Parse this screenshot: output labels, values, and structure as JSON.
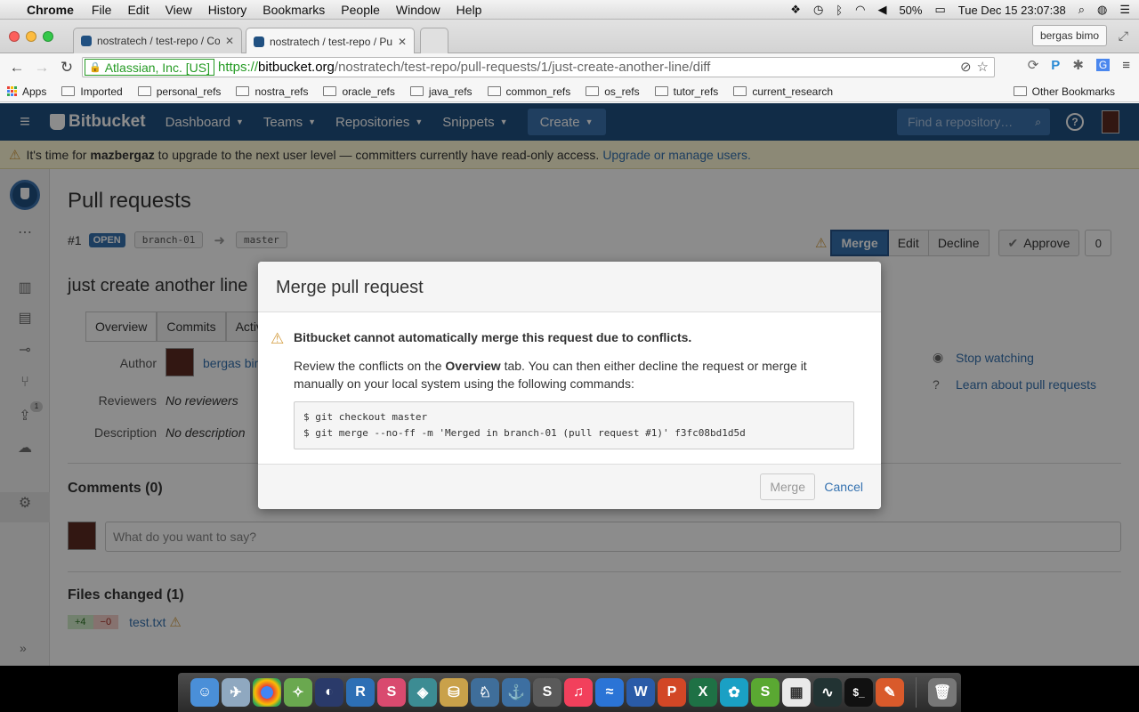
{
  "menubar": {
    "app_name": "Chrome",
    "menus": [
      "File",
      "Edit",
      "View",
      "History",
      "Bookmarks",
      "People",
      "Window",
      "Help"
    ],
    "battery": "50%",
    "datetime": "Tue Dec 15  23:07:38"
  },
  "tabs": [
    {
      "title": "nostratech / test-repo / Co"
    },
    {
      "title": "nostratech / test-repo / Pu"
    }
  ],
  "profile_name": "bergas bimo",
  "toolbar": {
    "ev_label": "Atlassian, Inc. [US]",
    "url_scheme": "https://",
    "url_host": "bitbucket.org",
    "url_path": "/nostratech/test-repo/pull-requests/1/just-create-another-line/diff"
  },
  "bookmarks": {
    "apps": "Apps",
    "folders": [
      "Imported",
      "personal_refs",
      "nostra_refs",
      "oracle_refs",
      "java_refs",
      "common_refs",
      "os_refs",
      "tutor_refs",
      "current_research"
    ],
    "other": "Other Bookmarks"
  },
  "bb_header": {
    "logo": "Bitbucket",
    "nav": [
      "Dashboard",
      "Teams",
      "Repositories",
      "Snippets"
    ],
    "create": "Create",
    "search_placeholder": "Find a repository…"
  },
  "notice": {
    "prefix": "It's time for",
    "user": "mazbergaz",
    "middle": "to upgrade to the next user level — committers currently have read-only access.",
    "link": "Upgrade or manage users."
  },
  "sidebar": {
    "badge": "1"
  },
  "pr": {
    "page_title": "Pull requests",
    "number": "#1",
    "state": "OPEN",
    "source_branch": "branch-01",
    "target_branch": "master",
    "actions": {
      "merge": "Merge",
      "edit": "Edit",
      "decline": "Decline",
      "approve": "Approve",
      "approve_count": "0"
    },
    "title": "just create another line",
    "tabs": [
      "Overview",
      "Commits",
      "Activ"
    ],
    "author_label": "Author",
    "author": "bergas bim",
    "reviewers_label": "Reviewers",
    "reviewers": "No reviewers",
    "description_label": "Description",
    "description": "No description",
    "side_links": [
      "Stop watching",
      "Learn about pull requests"
    ],
    "comments_heading": "Comments (0)",
    "comment_placeholder": "What do you want to say?",
    "files_heading": "Files changed (1)",
    "file": {
      "added": "+4",
      "removed": "−0",
      "name": "test.txt"
    }
  },
  "modal": {
    "title": "Merge pull request",
    "warning": "Bitbucket cannot automatically merge this request due to conflicts.",
    "body_prefix": "Review the conflicts on the",
    "body_strong": "Overview",
    "body_suffix": "tab. You can then either decline the request or merge it manually on your local system using the following commands:",
    "commands": [
      "$ git checkout master",
      "$ git merge --no-ff -m 'Merged in branch-01 (pull request #1)' f3fc08bd1d5d"
    ],
    "merge_button": "Merge",
    "cancel": "Cancel"
  },
  "colors": {
    "bitbucket_blue": "#205081",
    "link_blue": "#3572b0",
    "warning": "#d39c3f",
    "ev_green": "#259b24"
  }
}
